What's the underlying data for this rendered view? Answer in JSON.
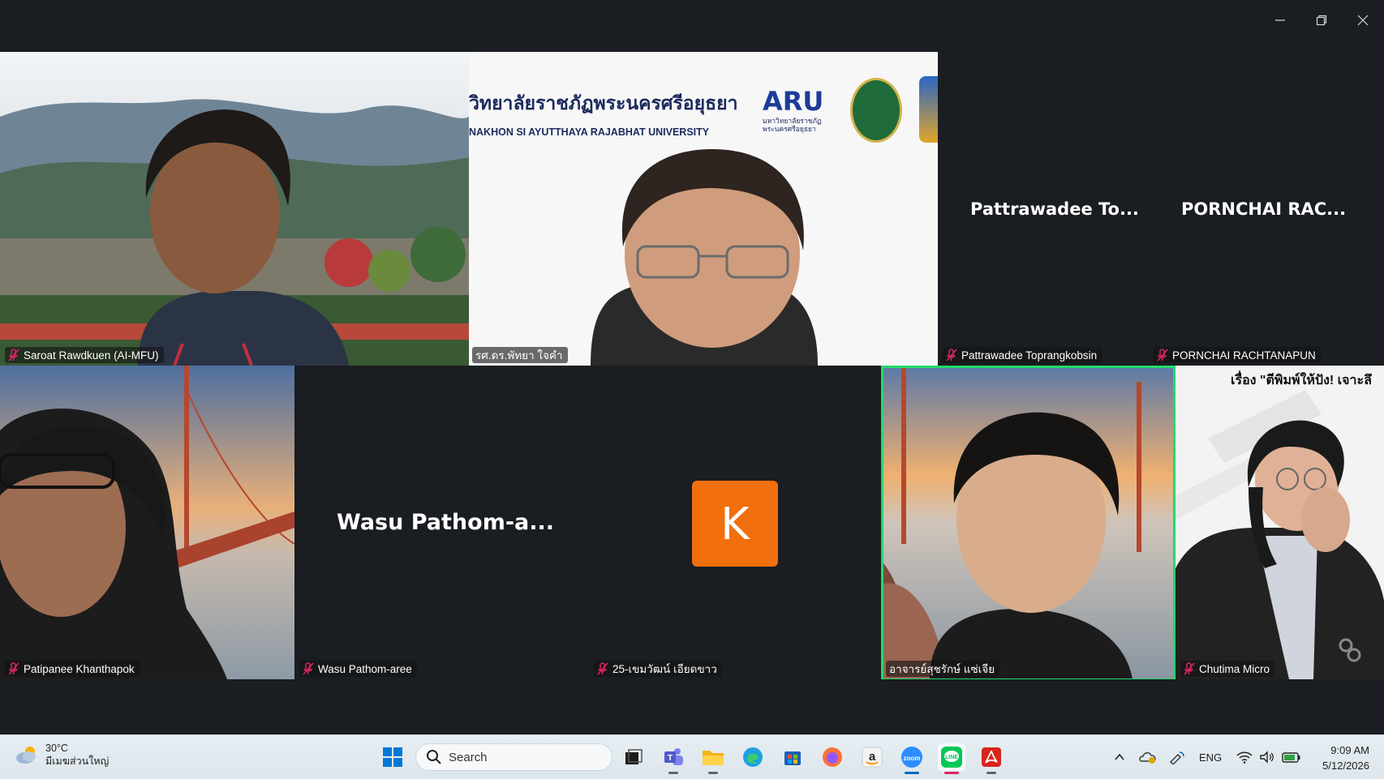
{
  "window": {
    "controls": [
      "minimize-icon",
      "restore-icon",
      "close-icon"
    ]
  },
  "participants": [
    {
      "id": "saroat",
      "name": "Saroat Rawdkuen (AI-MFU)",
      "muted": true,
      "video": true
    },
    {
      "id": "speaker-aru",
      "name": "รศ.ดร.พัทยา ใจคำ",
      "muted": false,
      "video": true,
      "background_text": {
        "university_thai": "วิทยาลัยราชภัฏพระนครศรีอยุธยา",
        "university_en": "NAKHON SI AYUTTHAYA RAJABHAT UNIVERSITY",
        "logo": "ARU",
        "logo_sub": "มหาวิทยาลัยราชภัฏ พระนครศรีอยุธยา"
      }
    },
    {
      "id": "pattrawadee",
      "name": "Pattrawadee Toprangkobsin",
      "display": "Pattrawadee  To...",
      "muted": true,
      "video": false
    },
    {
      "id": "pornchai",
      "name": "PORNCHAI RACHTANAPUN",
      "display": "PORNCHAI  RAC...",
      "muted": true,
      "video": false
    },
    {
      "id": "patipanee",
      "name": "Patipanee Khanthapok",
      "muted": true,
      "video": true
    },
    {
      "id": "wasu",
      "name": "Wasu Pathom-aree",
      "display": "Wasu  Pathom-a...",
      "muted": true,
      "video": false
    },
    {
      "id": "khemwat",
      "name": "25-เขมวัฒน์ เอียดขาว",
      "avatar_letter": "K",
      "muted": true,
      "video": false
    },
    {
      "id": "sutharak",
      "name": "อาจารย์สุชรักษ์ แซ่เจีย",
      "muted": false,
      "video": true,
      "active_speaker": true
    },
    {
      "id": "chutima",
      "name": "Chutima Micro",
      "muted": true,
      "video": true,
      "background_text": "เรื่อง \"ตีพิมพ์ให้ปัง! เจาะลึ"
    }
  ],
  "colors": {
    "active_speaker_border": "#23d96b",
    "avatar_bg": "#f26f0d",
    "mute_icon": "#e0245e",
    "background": "#1a1d21"
  },
  "taskbar": {
    "weather": {
      "temp": "30°C",
      "condition": "มีเมฆส่วนใหญ่",
      "icon": "cloud-sun-icon"
    },
    "search_placeholder": "Search",
    "pinned": [
      "windows-start-icon",
      "task-view-icon",
      "teams-icon",
      "file-explorer-icon",
      "edge-icon",
      "store-icon",
      "firefox-icon",
      "amazon-icon",
      "zoom-icon",
      "line-icon",
      "acrobat-icon"
    ],
    "active_app": "line-icon",
    "tray": {
      "language": "ENG",
      "icons": [
        "chevron-up-icon",
        "onedrive-icon",
        "pen-icon",
        "wifi-icon",
        "volume-icon",
        "battery-icon"
      ]
    },
    "clock": {
      "time": "9:09 AM",
      "date": "5/12/2026"
    }
  }
}
